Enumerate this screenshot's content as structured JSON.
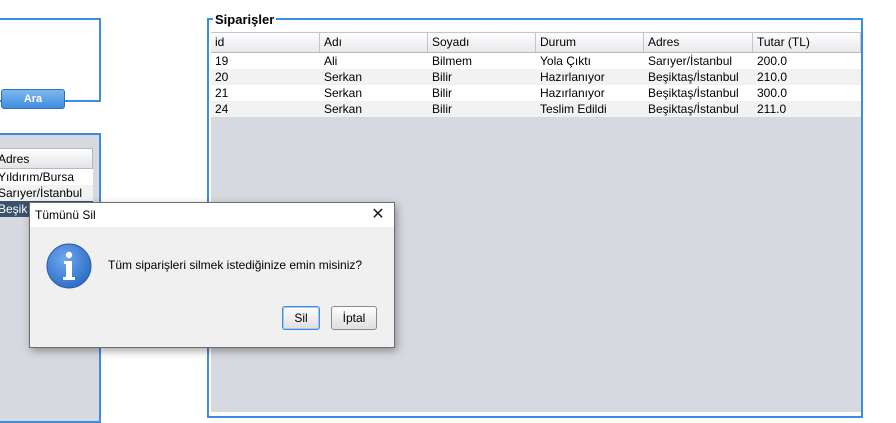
{
  "search": {
    "button_label": "Ara"
  },
  "left_table": {
    "header": "Adres",
    "rows": [
      "Yıldırım/Bursa",
      "Sarıyer/İstanbul",
      "Beşik"
    ]
  },
  "orders": {
    "title": "Siparişler",
    "columns": [
      "id",
      "Adı",
      "Soyadı",
      "Durum",
      "Adres",
      "Tutar (TL)"
    ],
    "rows": [
      [
        "19",
        "Ali",
        "Bilmem",
        "Yola Çıktı",
        "Sarıyer/İstanbul",
        "200.0"
      ],
      [
        "20",
        "Serkan",
        "Bilir",
        "Hazırlanıyor",
        "Beşiktaş/İstanbul",
        "210.0"
      ],
      [
        "21",
        "Serkan",
        "Bilir",
        "Hazırlanıyor",
        "Beşiktaş/İstanbul",
        "300.0"
      ],
      [
        "24",
        "Serkan",
        "Bilir",
        "Teslim Edildi",
        "Beşiktaş/İstanbul",
        "211.0"
      ]
    ]
  },
  "dialog": {
    "title": "Tümünü Sil",
    "close_glyph": "✕",
    "icon": "info-icon",
    "message": "Tüm siparişleri silmek istediğinize emin misiniz?",
    "confirm_label": "Sil",
    "cancel_label": "İptal"
  },
  "colors": {
    "accent_border": "#3c8ce0",
    "table_bg": "#d6d9df",
    "selected_row": "#39536e",
    "info_icon": "#2f6fc8"
  }
}
